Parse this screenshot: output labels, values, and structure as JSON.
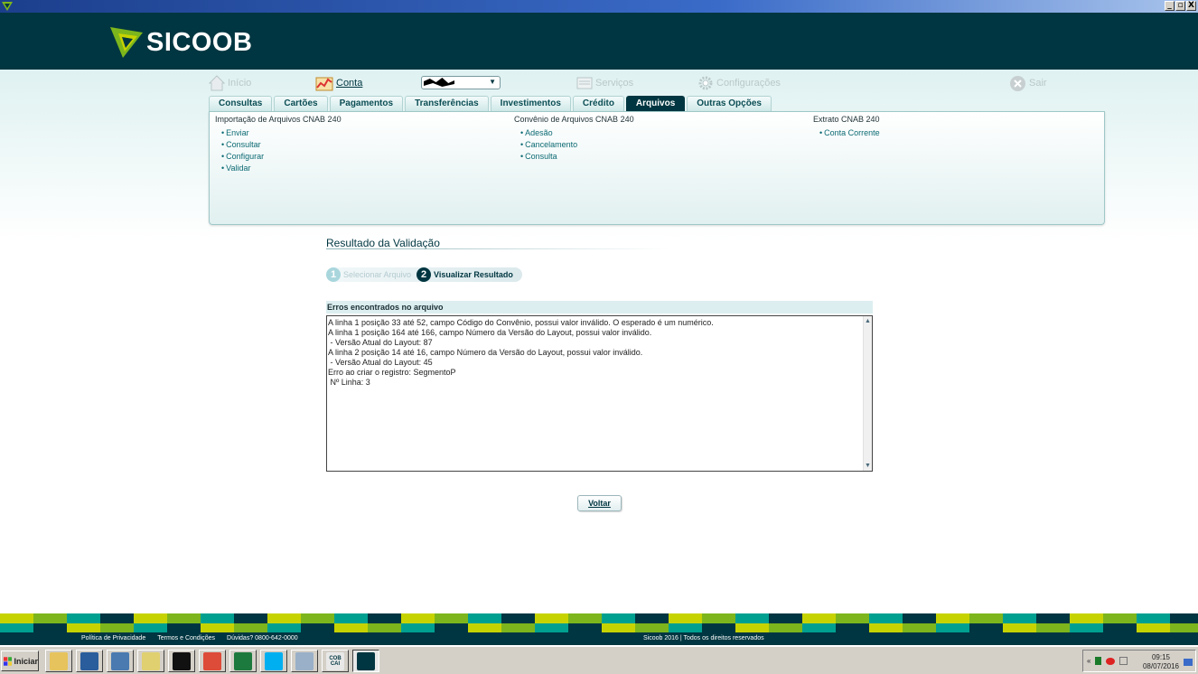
{
  "window": {
    "buttons": [
      "_",
      "▫",
      "X"
    ]
  },
  "brand": {
    "name": "SICOOB",
    "color": "#003641",
    "accent": "#7db61c"
  },
  "topnav": {
    "inicio": "Início",
    "conta": "Conta",
    "servicos": "Serviços",
    "configuracoes": "Configurações",
    "sair": "Sair"
  },
  "tabs": [
    {
      "label": "Consultas"
    },
    {
      "label": "Cartões"
    },
    {
      "label": "Pagamentos"
    },
    {
      "label": "Transferências"
    },
    {
      "label": "Investimentos"
    },
    {
      "label": "Crédito"
    },
    {
      "label": "Arquivos",
      "active": true
    },
    {
      "label": "Outras Opções"
    }
  ],
  "menu": {
    "col1": {
      "title": "Importação de Arquivos CNAB 240",
      "items": [
        "Enviar",
        "Consultar",
        "Configurar",
        "Validar"
      ]
    },
    "col2": {
      "title": "Convênio de Arquivos CNAB 240",
      "items": [
        "Adesão",
        "Cancelamento",
        "Consulta"
      ]
    },
    "col3": {
      "title": "Extrato CNAB 240",
      "items": [
        "Conta Corrente"
      ]
    }
  },
  "page": {
    "title": "Resultado da Validação",
    "steps": [
      {
        "num": "1",
        "label": "Selecionar Arquivo"
      },
      {
        "num": "2",
        "label": "Visualizar Resultado"
      }
    ],
    "errors_header": "Erros encontrados no arquivo",
    "errors_text": "A linha 1 posição 33 até 52, campo Código do Convênio, possui valor inválido. O esperado é um numérico.\nA linha 1 posição 164 até 166, campo Número da Versão do Layout, possui valor inválido.\n - Versão Atual do Layout: 87\nA linha 2 posição 14 até 16, campo Número da Versão do Layout, possui valor inválido.\n - Versão Atual do Layout: 45\nErro ao criar o registro: SegmentoP\n Nº Linha: 3",
    "back_button": "Voltar"
  },
  "footer": {
    "links": [
      "Política de Privacidade",
      "Termos e Condições",
      "Dúvidas? 0800-642-0000"
    ],
    "copyright": "Sicoob 2016 | Todos os direitos reservados"
  },
  "mosaic_colors": [
    "#c7d300",
    "#7db61c",
    "#00a091",
    "#003641",
    "#c7d300",
    "#7db61c",
    "#00a091",
    "#003641"
  ],
  "taskbar": {
    "start_label": "Iniciar",
    "apps": [
      {
        "name": "folder-icon",
        "color": "#e6c35c",
        "label": ""
      },
      {
        "name": "thunderbird-icon",
        "color": "#2a5d9b",
        "label": ""
      },
      {
        "name": "text-editor-icon",
        "color": "#4a7ab0",
        "label": ""
      },
      {
        "name": "notes-icon",
        "color": "#e0d070",
        "label": ""
      },
      {
        "name": "terminal-icon",
        "color": "#111111",
        "label": ""
      },
      {
        "name": "chrome-icon",
        "color": "#dd4b39",
        "label": ""
      },
      {
        "name": "excel-icon",
        "color": "#1d7a3e",
        "label": ""
      },
      {
        "name": "skype-icon",
        "color": "#00aff0",
        "label": ""
      },
      {
        "name": "calculator-icon",
        "color": "#9ab0c8",
        "label": ""
      },
      {
        "name": "cobcai-icon",
        "color": "#e8e8e8",
        "label": "COB CAI"
      },
      {
        "name": "sicoob-icon",
        "color": "#003641",
        "label": ""
      }
    ],
    "clock_time": "09:15",
    "clock_date": "08/07/2016"
  }
}
